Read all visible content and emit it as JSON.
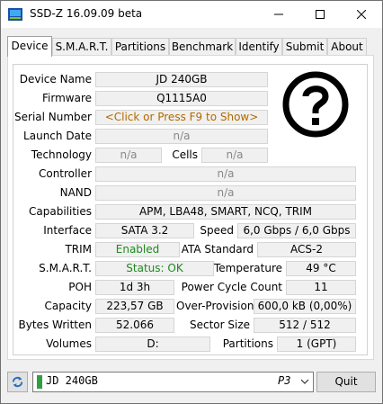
{
  "window": {
    "title": "SSD-Z 16.09.09 beta"
  },
  "tabs": [
    "Device",
    "S.M.A.R.T.",
    "Partitions",
    "Benchmark",
    "Identify",
    "Submit",
    "About"
  ],
  "device": {
    "labels": {
      "device_name": "Device Name",
      "firmware": "Firmware",
      "serial_number": "Serial Number",
      "launch_date": "Launch Date",
      "technology": "Technology",
      "cells": "Cells",
      "controller": "Controller",
      "nand": "NAND",
      "capabilities": "Capabilities",
      "interface": "Interface",
      "speed": "Speed",
      "trim": "TRIM",
      "ata_standard": "ATA Standard",
      "smart": "S.M.A.R.T.",
      "temperature": "Temperature",
      "poh": "POH",
      "power_cycle_count": "Power Cycle Count",
      "capacity": "Capacity",
      "over_provision": "Over-Provision",
      "bytes_written": "Bytes Written",
      "sector_size": "Sector Size",
      "volumes": "Volumes",
      "partitions": "Partitions"
    },
    "values": {
      "device_name": "JD 240GB",
      "firmware": "Q1115A0",
      "serial_number": "<Click or Press F9 to Show>",
      "launch_date": "n/a",
      "technology": "n/a",
      "cells": "n/a",
      "controller": "n/a",
      "nand": "n/a",
      "capabilities": "APM, LBA48, SMART, NCQ, TRIM",
      "interface": "SATA 3.2",
      "speed": "6,0 Gbps / 6,0 Gbps",
      "trim": "Enabled",
      "ata_standard": "ACS-2",
      "smart": "Status: OK",
      "temperature": "49 °C",
      "poh": "1d 3h",
      "power_cycle_count": "11",
      "capacity": "223,57 GB",
      "over_provision": "600,0 kB (0,00%)",
      "bytes_written": "52.066",
      "sector_size": "512 / 512",
      "volumes": "D:",
      "partitions": "1 (GPT)"
    },
    "image_icon": "question-mark-icon"
  },
  "bottom": {
    "drive": "JD 240GB",
    "port": "P3",
    "quit_label": "Quit"
  },
  "colors": {
    "ok_green": "#1e8a1e",
    "serial_orange": "#b06a00",
    "drive_bar": "#2ea043"
  }
}
